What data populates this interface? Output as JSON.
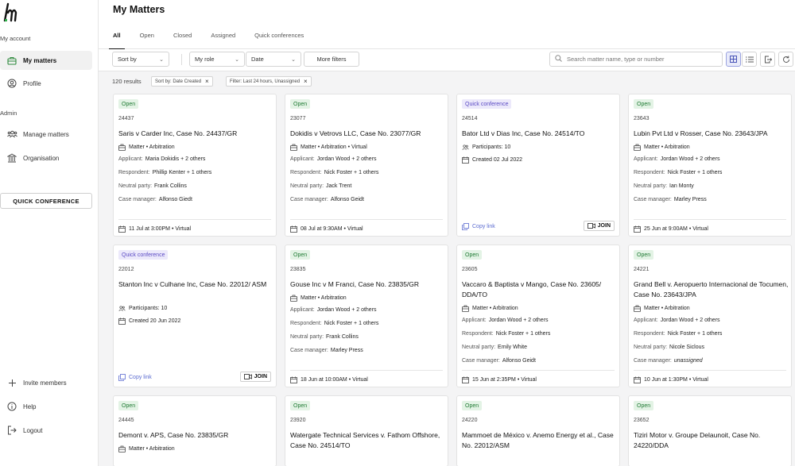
{
  "sidebar": {
    "my_account_label": "My account",
    "admin_label": "Admin",
    "my_matters": "My matters",
    "profile": "Profile",
    "manage_matters": "Manage matters",
    "organisation": "Organisation",
    "quick_conference": "QUICK CONFERENCE",
    "invite_members": "Invite members",
    "help": "Help",
    "logout": "Logout"
  },
  "header": {
    "title": "My Matters",
    "tabs": [
      "All",
      "Open",
      "Closed",
      "Assigned",
      "Quick conferences"
    ]
  },
  "filters": {
    "sort_by": "Sort by",
    "my_role": "My role",
    "date": "Date",
    "more_filters": "More filters",
    "search_placeholder": "Search matter name, type or number"
  },
  "results": {
    "count": "120 results",
    "chip_sort": "Sort by: Date Created",
    "chip_filter": "Filter: Last 24 hours, Unassigned"
  },
  "cards": [
    {
      "badge": "Open",
      "number": "24437",
      "title": "Saris v Carder Inc, Case No. 24437/GR",
      "type": "Matter • Arbitration",
      "applicant_label": "Applicant:",
      "applicant": "Maria Dokidis + 2 others",
      "respondent_label": "Respondent:",
      "respondent": "Phillip Kenter + 1 others",
      "neutral_label": "Neutral party:",
      "neutral": "Frank Collins",
      "manager_label": "Case manager:",
      "manager": "Alfonso Giedt",
      "date": "11 Jul at 3:00PM • Virtual"
    },
    {
      "badge": "Open",
      "number": "23077",
      "title": "Dokidis v Vetrovs LLC, Case No. 23077/GR",
      "type": "Matter • Arbitration • Virtual",
      "applicant_label": "Applicant:",
      "applicant": "Jordan Wood + 2 others",
      "respondent_label": "Respondent:",
      "respondent": "Nick Foster + 1 others",
      "neutral_label": "Neutral party:",
      "neutral": "Jack Trent",
      "manager_label": "Case manager:",
      "manager": "Alfonso Geidt",
      "date": "08 Jul at 9:30AM • Virtual"
    },
    {
      "badge": "Quick conference",
      "number": "24514",
      "title": "Bator Ltd v Dias Inc, Case No. 24514/TO",
      "participants": "Participants: 10",
      "created": "Created 02 Jul 2022",
      "copy": "Copy link",
      "join": "JOIN"
    },
    {
      "badge": "Open",
      "number": "23643",
      "title": "Lubin Pvt Ltd v Rosser, Case No. 23643/JPA",
      "type": "Matter • Arbitration",
      "applicant_label": "Applicant:",
      "applicant": "Jordan Wood + 2 others",
      "respondent_label": "Respondent:",
      "respondent": "Nick Foster + 1 others",
      "neutral_label": "Neutral party:",
      "neutral": "Ian Monty",
      "manager_label": "Case manager:",
      "manager": "Marley Press",
      "date": "25 Jun at 9:00AM • Virtual"
    },
    {
      "badge": "Quick conference",
      "number": "22012",
      "title": "Stanton Inc v Culhane Inc, Case No. 22012/ ASM",
      "participants": "Participants: 10",
      "created": "Created 20 Jun 2022",
      "copy": "Copy link",
      "join": "JOIN"
    },
    {
      "badge": "Open",
      "number": "23835",
      "title": "Gouse Inc v M Franci, Case No. 23835/GR",
      "type": "Matter • Arbitration",
      "applicant_label": "Applicant:",
      "applicant": "Jordan Wood + 2 others",
      "respondent_label": "Respondent:",
      "respondent": "Nick Foster + 1 others",
      "neutral_label": "Neutral party:",
      "neutral": "Frank Collins",
      "manager_label": "Case manager:",
      "manager": "Marley Press",
      "date": "18 Jun at 10:00AM • Virtual"
    },
    {
      "badge": "Open",
      "number": "23605",
      "title": "Vaccaro & Baptista v Mango, Case No. 23605/ DDA/TO",
      "type": "Matter • Arbitration",
      "applicant_label": "Applicant:",
      "applicant": "Jordan Wood + 2 others",
      "respondent_label": "Respondent:",
      "respondent": "Nick Foster + 1 others",
      "neutral_label": "Neutral party:",
      "neutral": "Emily White",
      "manager_label": "Case manager:",
      "manager": "Alfonso Geidt",
      "date": "15 Jun at 2:35PM • Virtual"
    },
    {
      "badge": "Open",
      "number": "24221",
      "title": "Grand Bell v. Aeropuerto Internacional de Tocumen, Case No. 23643/JPA",
      "type": "Matter • Arbitration",
      "applicant_label": "Applicant:",
      "applicant": "Jordan Wood + 2 others",
      "respondent_label": "Respondent:",
      "respondent": "Nick Foster + 1 others",
      "neutral_label": "Neutral party:",
      "neutral": "Nicole Siclous",
      "manager_label": "Case manager:",
      "manager": "unassigned",
      "date": "10 Jun at 1:30PM • Virtual"
    },
    {
      "badge": "Open",
      "number": "24445",
      "title": "Demont v. APS, Case No. 23835/GR",
      "type": "Matter • Arbitration"
    },
    {
      "badge": "Open",
      "number": "23920",
      "title": "Watergate Technical Services v. Fathom Offshore, Case No. 24514/TO"
    },
    {
      "badge": "Open",
      "number": "24220",
      "title": "Mammoet de México v. Anemo Energy et al., Case No. 22012/ASM"
    },
    {
      "badge": "Open",
      "number": "23652",
      "title": "Tiziri Motor v. Groupe Delaunoit, Case No. 24220/DDA"
    }
  ],
  "colors": {
    "open_bg": "#e3f3e5",
    "open_text": "#1f7a33",
    "qc_bg": "#ece9fb",
    "qc_text": "#5b4bc4",
    "link": "#5b6bd0"
  }
}
